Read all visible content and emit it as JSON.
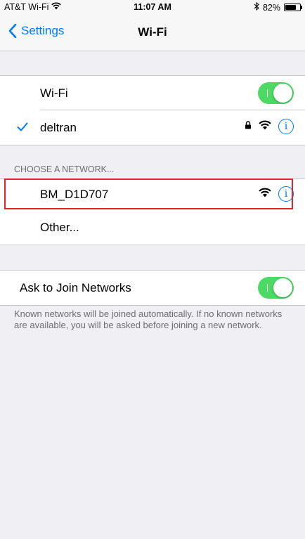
{
  "status_bar": {
    "carrier": "AT&T Wi-Fi",
    "time": "11:07 AM",
    "battery": "82%",
    "battery_level": 0.82
  },
  "nav": {
    "back_label": "Settings",
    "title": "Wi-Fi"
  },
  "wifi_group": {
    "toggle_label": "Wi-Fi",
    "toggle_on": true,
    "connected_network": "deltran"
  },
  "choose_section": {
    "header": "CHOOSE A NETWORK...",
    "networks": [
      {
        "name": "BM_D1D707",
        "secured": false
      }
    ],
    "other_label": "Other..."
  },
  "ask_join": {
    "label": "Ask to Join Networks",
    "toggle_on": true,
    "note": "Known networks will be joined automatically. If no known networks are available, you will be asked before joining a new network."
  },
  "icons": {
    "wifi": "wifi-icon",
    "lock": "lock-icon",
    "info": "info-icon",
    "checkmark": "checkmark-icon",
    "bluetooth": "bluetooth-icon"
  },
  "colors": {
    "accent": "#007aff",
    "toggle_on": "#4cd964",
    "highlight": "#e3242b"
  }
}
